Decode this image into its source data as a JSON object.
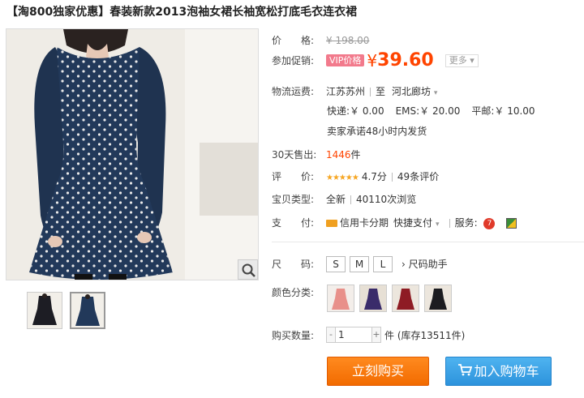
{
  "title": "【淘800独家优惠】春装新款2013泡袖女裙长袖宽松打底毛衣连衣裙",
  "price": {
    "label": "价　　格:",
    "original": "¥ 198.00"
  },
  "promo": {
    "label": "参加促销:",
    "vip": "VIP价格",
    "currency": "¥",
    "amount": "39.60",
    "more": "更多"
  },
  "shipping": {
    "label": "物流运费:",
    "from": "江苏苏州",
    "to_prefix": "至",
    "to": "河北廊坊",
    "express": "快递:￥ 0.00",
    "ems": "EMS:￥ 20.00",
    "post": "平邮:￥ 10.00",
    "promise": "卖家承诺48小时内发货"
  },
  "sales": {
    "label": "30天售出:",
    "count": "1446",
    "unit": "件"
  },
  "rating": {
    "label": "评　　价:",
    "stars": "★★★★★",
    "score": "4.7分",
    "reviews": "49条评价"
  },
  "condition": {
    "label": "宝贝类型:",
    "value": "全新",
    "views": "40110次浏览"
  },
  "payment": {
    "label": "支　　付:",
    "credit": "信用卡分期",
    "quick": "快捷支付",
    "service_label": "服务:"
  },
  "size": {
    "label": "尺　　码:",
    "options": [
      "S",
      "M",
      "L"
    ],
    "helper": "尺码助手"
  },
  "color": {
    "label": "颜色分类:"
  },
  "quantity": {
    "label": "购买数量:",
    "minus": "-",
    "value": "1",
    "plus": "+",
    "stock": "件 (库存13511件)"
  },
  "buttons": {
    "buy": "立刻购买",
    "cart": "加入购物车"
  },
  "colors": {
    "accent": "#ff4400",
    "buy": "#f26b00",
    "cart": "#2d93dc",
    "dress": "#22395a",
    "vip": "#f27a8c"
  }
}
